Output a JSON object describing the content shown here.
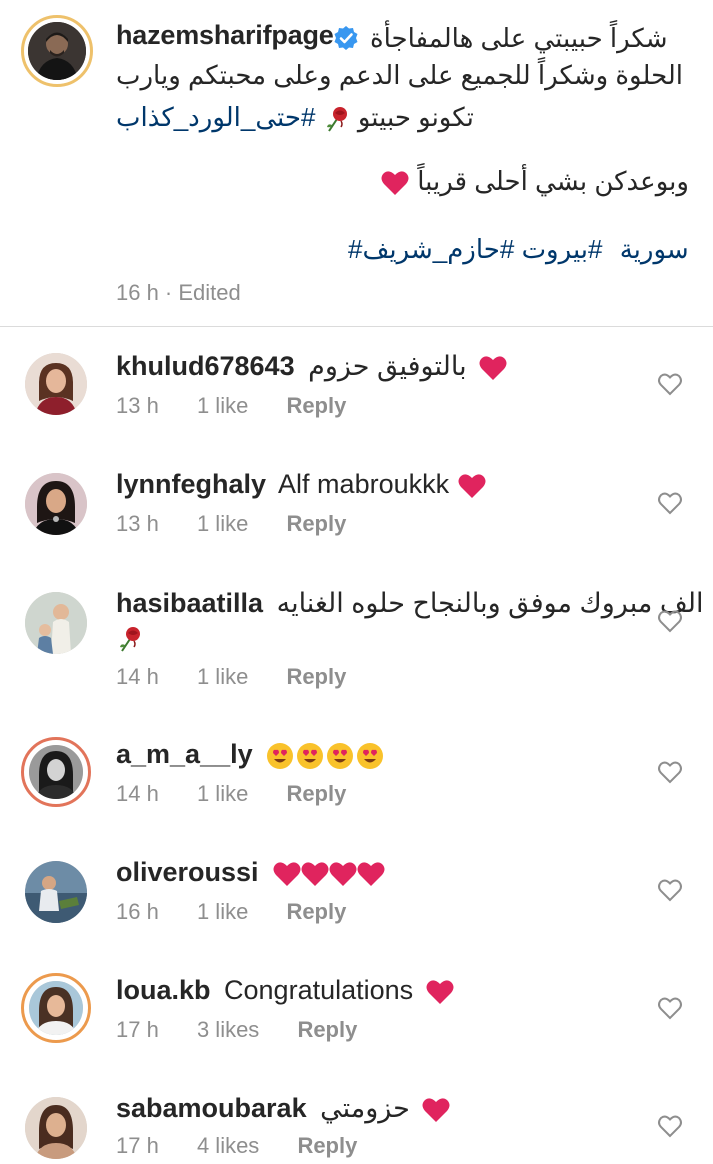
{
  "post": {
    "username": "hazemsharifpage",
    "verified": true,
    "line1": "شكراً حبيبتي على هالمفاجأة",
    "line2": "الحلوة وشكراً للجميع على الدعم وعلى محبتكم ويارب",
    "line3_text": "تكونو حبيتو",
    "line3_tag": "#حتى_الورد_كذاب",
    "line4": "وبوعدكن بشي أحلى قريباً",
    "tags": [
      "#حازم_شريف",
      "#بيروت",
      "#سورية"
    ],
    "meta": "16 h · Edited",
    "colors": {
      "link": "#00376b",
      "heart": "#e0245e",
      "verified": "#3897f0",
      "meta": "#8e8e8e"
    }
  },
  "comments": [
    {
      "username": "khulud678643",
      "text": "بالتوفيق حزوم",
      "trailing": "heart",
      "time": "13 h",
      "likes": "1 like",
      "reply": "Reply"
    },
    {
      "username": "lynnfeghaly",
      "text": "Alf mabroukkk",
      "trailing": "heart",
      "time": "13 h",
      "likes": "1 like",
      "reply": "Reply"
    },
    {
      "username": "hasibaatilla",
      "text": "الف مبروك موفق وبالنجاح حلوه الغنايه",
      "trailing": "rose",
      "time": "14 h",
      "likes": "1 like",
      "reply": "Reply"
    },
    {
      "username": "a_m_a__ly",
      "text": "",
      "trailing": "heart-eyes x4",
      "time": "14 h",
      "likes": "1 like",
      "reply": "Reply"
    },
    {
      "username": "oliveroussi",
      "text": "",
      "trailing": "hearts x4",
      "time": "16 h",
      "likes": "1 like",
      "reply": "Reply"
    },
    {
      "username": "loua.kb",
      "text": "Congratulations",
      "trailing": "heart",
      "time": "17 h",
      "likes": "3 likes",
      "reply": "Reply"
    },
    {
      "username": "sabamoubarak",
      "text": "حزومتي",
      "trailing": "heart",
      "time": "17 h",
      "likes": "4 likes",
      "reply": "Reply"
    }
  ]
}
